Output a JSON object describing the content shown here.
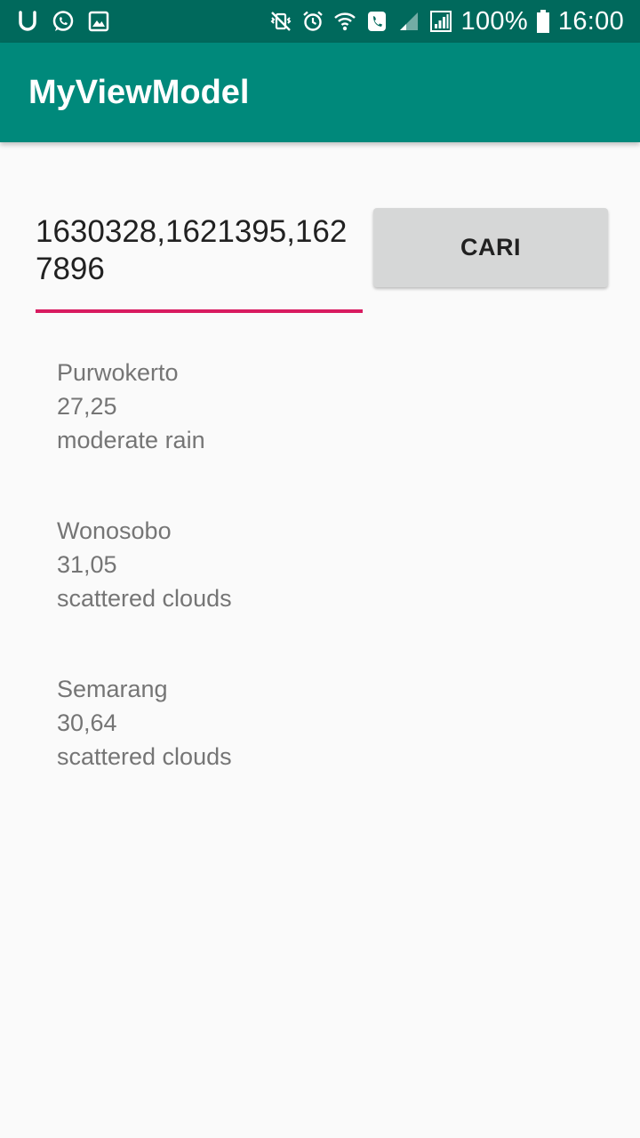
{
  "status_bar": {
    "left_icons": [
      "u-icon",
      "whatsapp-icon",
      "image-icon"
    ],
    "right_icons": [
      "mute-vibrate-icon",
      "alarm-icon",
      "wifi-icon",
      "call-icon",
      "signal-icon",
      "signal-bars-icon"
    ],
    "battery": "100%",
    "time": "16:00"
  },
  "app_bar": {
    "title": "MyViewModel"
  },
  "form": {
    "city_ids_value": "1630328,1621395,1627896",
    "search_button_label": "CARI",
    "accent_color": "#d81b60"
  },
  "weather": [
    {
      "city": "Purwokerto",
      "temperature": "27,25",
      "description": "moderate rain"
    },
    {
      "city": "Wonosobo",
      "temperature": "31,05",
      "description": "scattered clouds"
    },
    {
      "city": "Semarang",
      "temperature": "30,64",
      "description": "scattered clouds"
    }
  ],
  "colors": {
    "status_bar": "#00695c",
    "app_bar": "#00897b",
    "background": "#fafafa"
  }
}
